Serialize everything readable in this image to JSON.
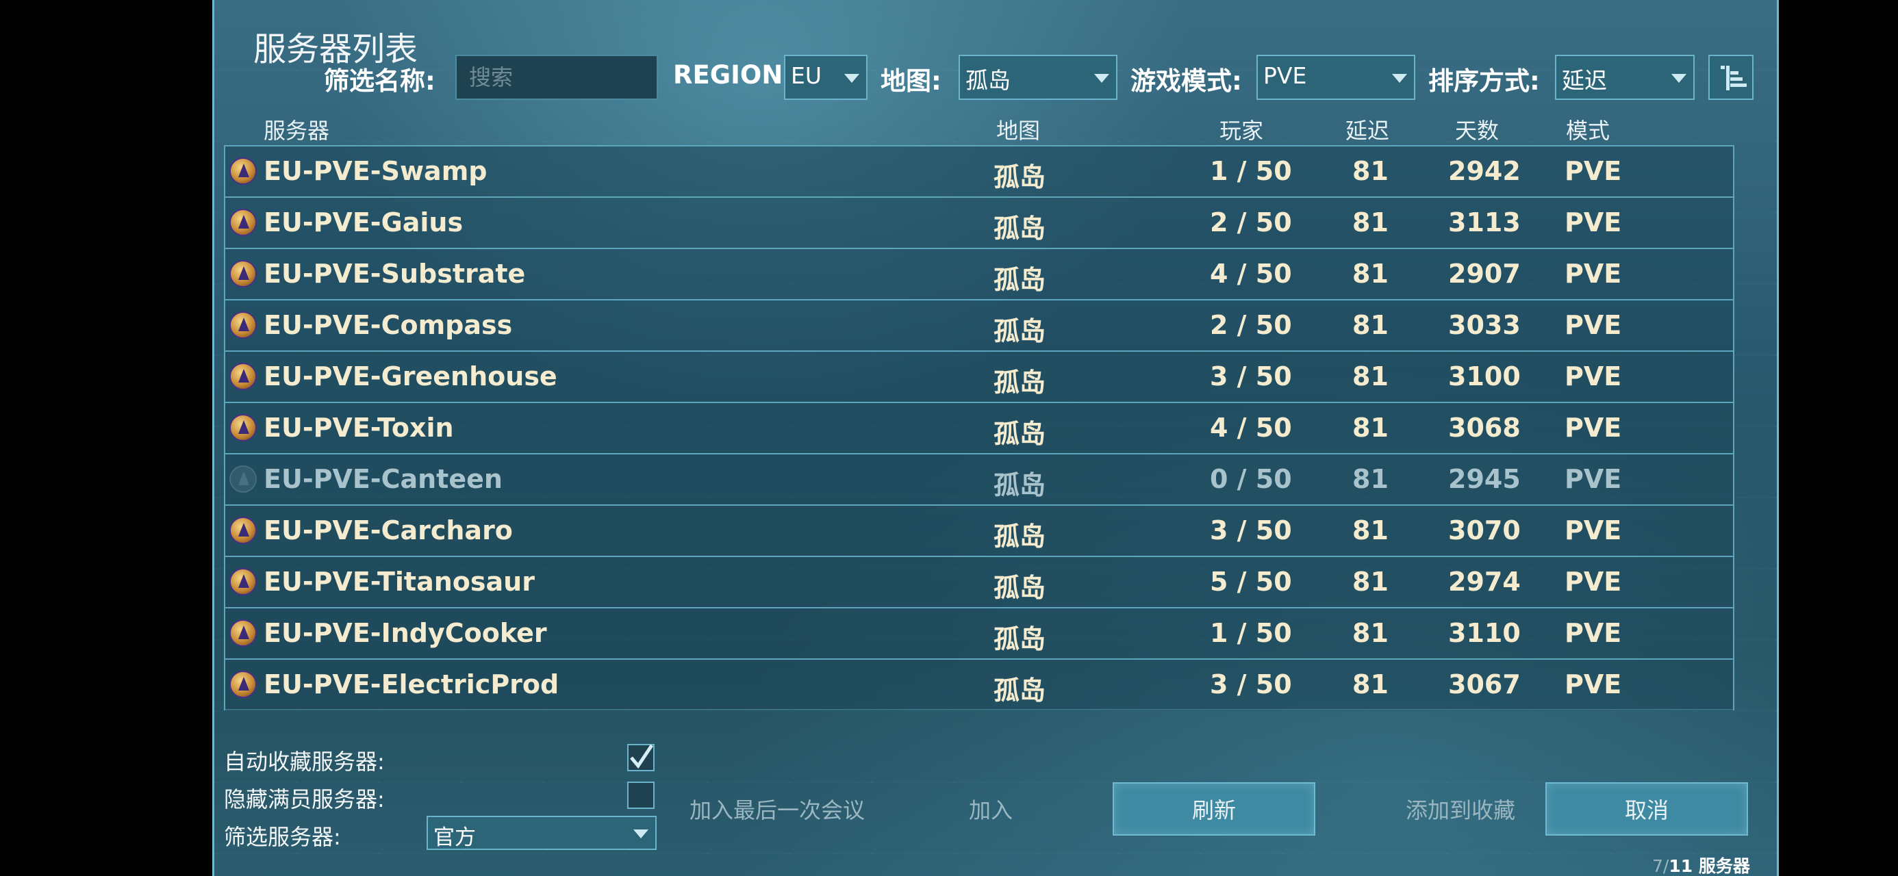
{
  "header": {
    "title": "服务器列表",
    "filter_name_label": "筛选名称:",
    "search_placeholder": "搜索",
    "region_label": "REGION:",
    "region_value": "EU",
    "map_label": "地图:",
    "map_value": "孤岛",
    "mode_label": "游戏模式:",
    "mode_value": "PVE",
    "sort_label": "排序方式:",
    "sort_value": "延迟"
  },
  "columns": {
    "server": "服务器",
    "map": "地图",
    "players": "玩家",
    "ping": "延迟",
    "days": "天数",
    "mode": "模式"
  },
  "rows": [
    {
      "name": "EU-PVE-Swamp",
      "map": "孤岛",
      "players": "1 / 50",
      "ping": "81",
      "days": "2942",
      "mode": "PVE"
    },
    {
      "name": "EU-PVE-Gaius",
      "map": "孤岛",
      "players": "2 / 50",
      "ping": "81",
      "days": "3113",
      "mode": "PVE"
    },
    {
      "name": "EU-PVE-Substrate",
      "map": "孤岛",
      "players": "4 / 50",
      "ping": "81",
      "days": "2907",
      "mode": "PVE"
    },
    {
      "name": "EU-PVE-Compass",
      "map": "孤岛",
      "players": "2 / 50",
      "ping": "81",
      "days": "3033",
      "mode": "PVE"
    },
    {
      "name": "EU-PVE-Greenhouse",
      "map": "孤岛",
      "players": "3 / 50",
      "ping": "81",
      "days": "3100",
      "mode": "PVE"
    },
    {
      "name": "EU-PVE-Toxin",
      "map": "孤岛",
      "players": "4 / 50",
      "ping": "81",
      "days": "3068",
      "mode": "PVE"
    },
    {
      "name": "EU-PVE-Canteen",
      "map": "孤岛",
      "players": "0 / 50",
      "ping": "81",
      "days": "2945",
      "mode": "PVE"
    },
    {
      "name": "EU-PVE-Carcharo",
      "map": "孤岛",
      "players": "3 / 50",
      "ping": "81",
      "days": "3070",
      "mode": "PVE"
    },
    {
      "name": "EU-PVE-Titanosaur",
      "map": "孤岛",
      "players": "5 / 50",
      "ping": "81",
      "days": "2974",
      "mode": "PVE"
    },
    {
      "name": "EU-PVE-IndyCooker",
      "map": "孤岛",
      "players": "1 / 50",
      "ping": "81",
      "days": "3110",
      "mode": "PVE"
    },
    {
      "name": "EU-PVE-ElectricProd",
      "map": "孤岛",
      "players": "3 / 50",
      "ping": "81",
      "days": "3067",
      "mode": "PVE"
    }
  ],
  "options": {
    "auto_favorite_label": "自动收藏服务器:",
    "auto_favorite_checked": true,
    "hide_full_label": "隐藏满员服务器:",
    "hide_full_checked": false,
    "filter_servers_label": "筛选服务器:",
    "filter_servers_value": "官方"
  },
  "buttons": {
    "join_last": "加入最后一次会议",
    "join": "加入",
    "refresh": "刷新",
    "add_favorite": "添加到收藏",
    "cancel": "取消"
  },
  "footer": {
    "shown": "7",
    "sep": "/",
    "total": "11 服务器"
  }
}
